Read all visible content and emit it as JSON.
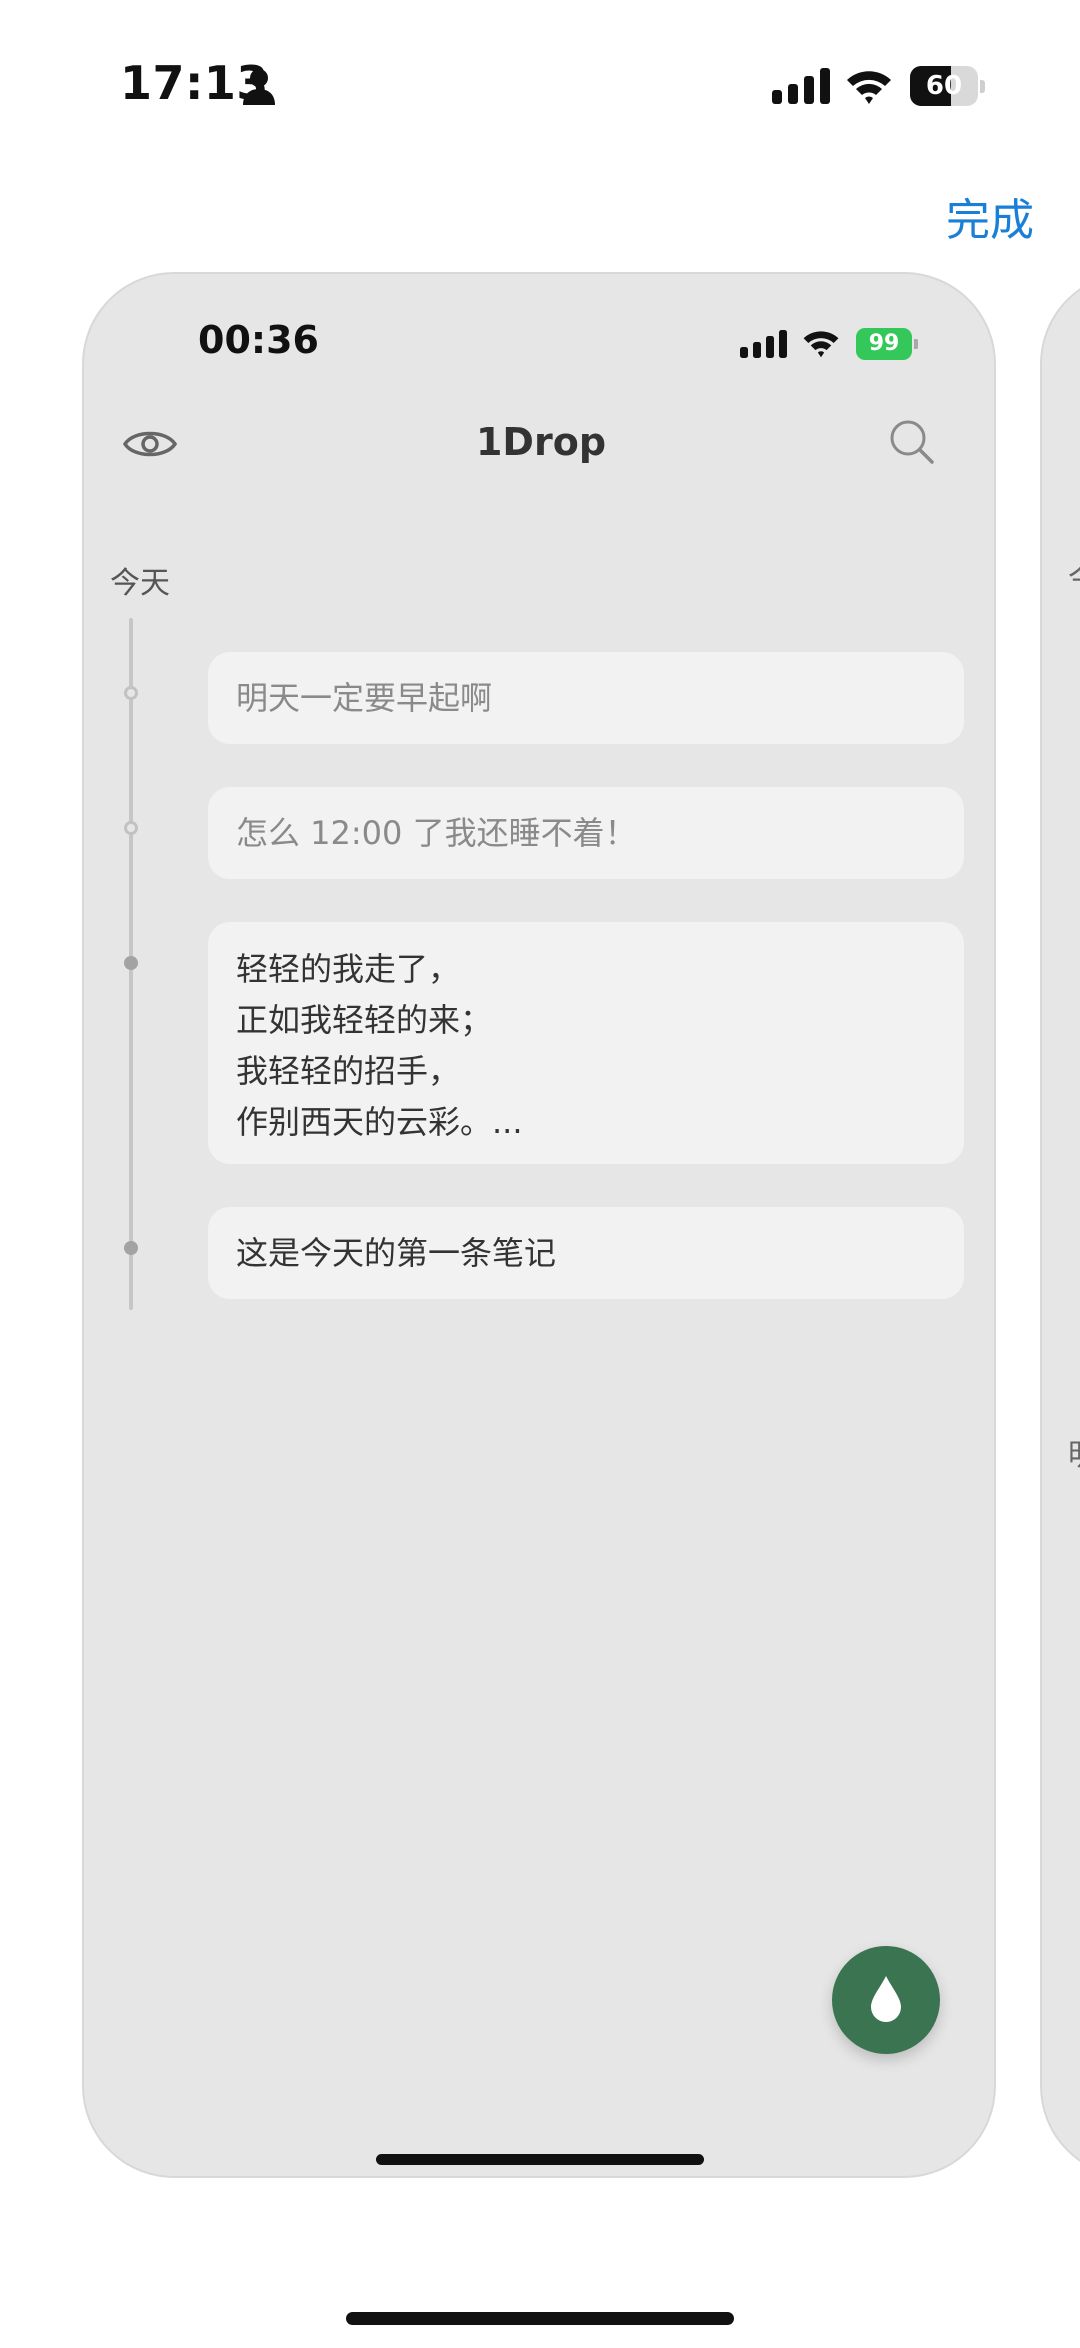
{
  "status_bar": {
    "time": "17:13",
    "battery_level": "60",
    "battery_fill_fraction": 0.6
  },
  "header": {
    "done_label": "完成"
  },
  "preview": {
    "status_bar": {
      "time": "00:36",
      "battery_level": "99"
    },
    "title": "1Drop",
    "section_label": "今天",
    "notes": [
      {
        "lines": [
          "明天一定要早起啊"
        ],
        "faded": true
      },
      {
        "lines": [
          "怎么 12:00 了我还睡不着！"
        ],
        "faded": true
      },
      {
        "lines": [
          "轻轻的我走了，",
          "正如我轻轻的来；",
          "我轻轻的招手，",
          "作别西天的云彩。..."
        ],
        "faded": false
      },
      {
        "lines": [
          "这是今天的第一条笔记"
        ],
        "faded": false
      }
    ],
    "accent_color": "#3a7450",
    "icons": [
      "eye-icon",
      "search-icon",
      "water-drop-icon"
    ]
  },
  "next_preview": {
    "fragments": [
      "今",
      "明"
    ]
  },
  "colors": {
    "link": "#1a7fd6",
    "card_background": "#e6e6e6",
    "note_background": "#f2f2f2",
    "battery_charging": "#34c759"
  }
}
